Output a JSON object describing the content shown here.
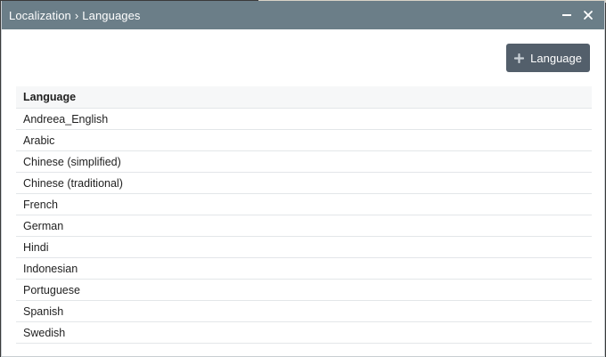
{
  "window": {
    "breadcrumb_root": "Localization",
    "breadcrumb_sep": "›",
    "breadcrumb_page": "Languages",
    "minimize_icon": "minimize-icon",
    "close_icon": "close-icon"
  },
  "toolbar": {
    "add_label": "Language",
    "add_icon": "plus-icon"
  },
  "table": {
    "column_header": "Language",
    "rows": [
      "Andreea_English",
      "Arabic",
      "Chinese (simplified)",
      "Chinese (traditional)",
      "French",
      "German",
      "Hindi",
      "Indonesian",
      "Portuguese",
      "Spanish",
      "Swedish"
    ]
  },
  "colors": {
    "titlebar": "#6b7e88",
    "add_button": "#535f6b"
  }
}
